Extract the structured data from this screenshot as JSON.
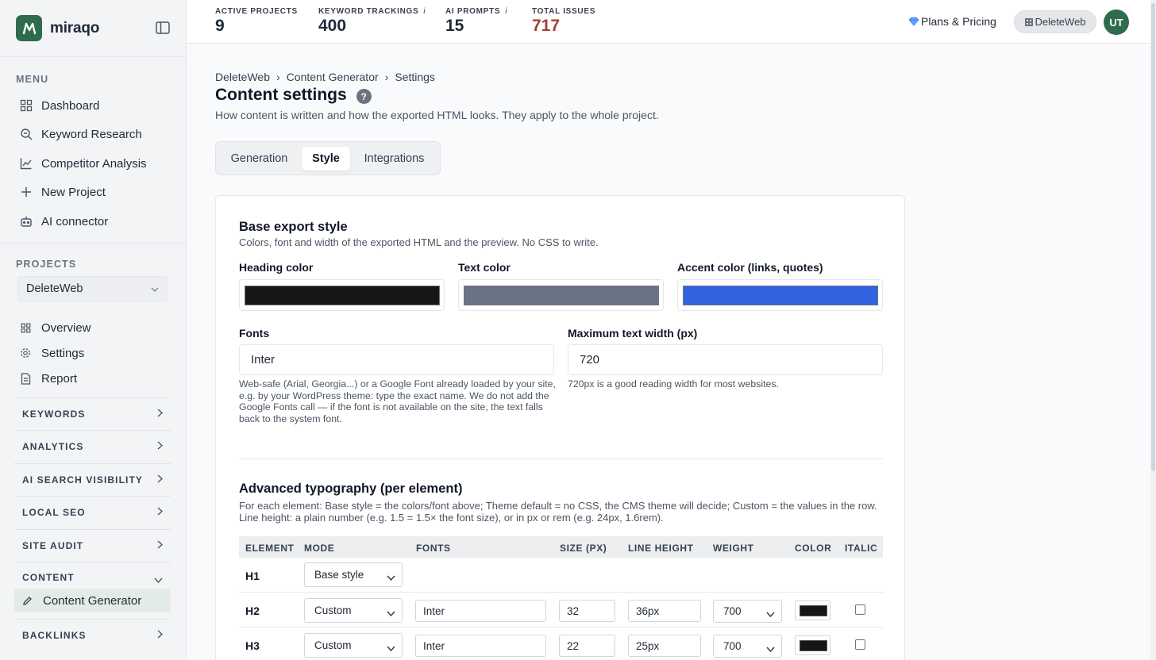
{
  "brand": {
    "name": "miraqo"
  },
  "sidebar": {
    "menu_title": "MENU",
    "menu": [
      {
        "label": "Dashboard",
        "icon": "grid-icon"
      },
      {
        "label": "Keyword Research",
        "icon": "search-icon"
      },
      {
        "label": "Competitor Analysis",
        "icon": "chart-line-icon"
      },
      {
        "label": "New Project",
        "icon": "plus-icon"
      },
      {
        "label": "AI connector",
        "icon": "robot-icon"
      }
    ],
    "projects_title": "PROJECTS",
    "project_selected": "DeleteWeb",
    "project_items": [
      {
        "label": "Overview",
        "icon": "grid-icon"
      },
      {
        "label": "Settings",
        "icon": "gear-icon"
      },
      {
        "label": "Report",
        "icon": "document-icon"
      }
    ],
    "sections": [
      {
        "label": "KEYWORDS",
        "open": false
      },
      {
        "label": "ANALYTICS",
        "open": false
      },
      {
        "label": "AI SEARCH VISIBILITY",
        "open": false
      },
      {
        "label": "LOCAL SEO",
        "open": false
      },
      {
        "label": "SITE AUDIT",
        "open": false
      },
      {
        "label": "CONTENT",
        "open": true
      }
    ],
    "content_active_item": "Content Generator",
    "last_section": "BACKLINKS"
  },
  "topbar": {
    "stats": [
      {
        "label": "ACTIVE PROJECTS",
        "value": "9",
        "info": false
      },
      {
        "label": "KEYWORD TRACKINGS",
        "value": "400",
        "info": true
      },
      {
        "label": "AI PROMPTS",
        "value": "15",
        "info": true
      },
      {
        "label": "TOTAL ISSUES",
        "value": "717",
        "info": false
      }
    ],
    "info_glyph": "i",
    "plans_label": "Plans & Pricing",
    "workspace_label": "DeleteWeb",
    "avatar_initials": "UT",
    "issues_color": "#a13e3a"
  },
  "breadcrumb": [
    "DeleteWeb",
    "Content Generator",
    "Settings"
  ],
  "breadcrumb_sep": "›",
  "page": {
    "title": "Content settings",
    "help_glyph": "?",
    "description": "How content is written and how the exported HTML looks. They apply to the whole project."
  },
  "tabs": [
    {
      "label": "Generation",
      "active": false
    },
    {
      "label": "Style",
      "active": true
    },
    {
      "label": "Integrations",
      "active": false
    }
  ],
  "base_style": {
    "title": "Base export style",
    "description": "Colors, font and width of the exported HTML and the preview. No CSS to write.",
    "heading_color_label": "Heading color",
    "heading_color": "#161616",
    "text_color_label": "Text color",
    "text_color": "#6b7386",
    "accent_color_label": "Accent color (links, quotes)",
    "accent_color": "#3264e0",
    "fonts_label": "Fonts",
    "fonts_value": "Inter",
    "fonts_hint": "Web-safe (Arial, Georgia...) or a Google Font already loaded by your site, e.g. by your WordPress theme: type the exact name. We do not add the Google Fonts call — if the font is not available on the site, the text falls back to the system font.",
    "max_width_label": "Maximum text width (px)",
    "max_width_value": "720",
    "max_width_hint": "720px is a good reading width for most websites."
  },
  "advanced": {
    "title": "Advanced typography (per element)",
    "description": "For each element: Base style = the colors/font above; Theme default = no CSS, the CMS theme will decide; Custom = the values in the row. Line height: a plain number (e.g. 1.5 = 1.5× the font size), or in px or rem (e.g. 24px, 1.6rem).",
    "columns": [
      "ELEMENT",
      "MODE",
      "FONTS",
      "SIZE (PX)",
      "LINE HEIGHT",
      "WEIGHT",
      "COLOR",
      "ITALIC"
    ],
    "rows": [
      {
        "element": "H1",
        "mode": "Base style",
        "custom": false
      },
      {
        "element": "H2",
        "mode": "Custom",
        "custom": true,
        "font": "Inter",
        "size": "32",
        "line_height": "36px",
        "weight": "700",
        "color": "#161616",
        "italic": false
      },
      {
        "element": "H3",
        "mode": "Custom",
        "custom": true,
        "font": "Inter",
        "size": "22",
        "line_height": "25px",
        "weight": "700",
        "color": "#161616",
        "italic": false
      }
    ]
  }
}
